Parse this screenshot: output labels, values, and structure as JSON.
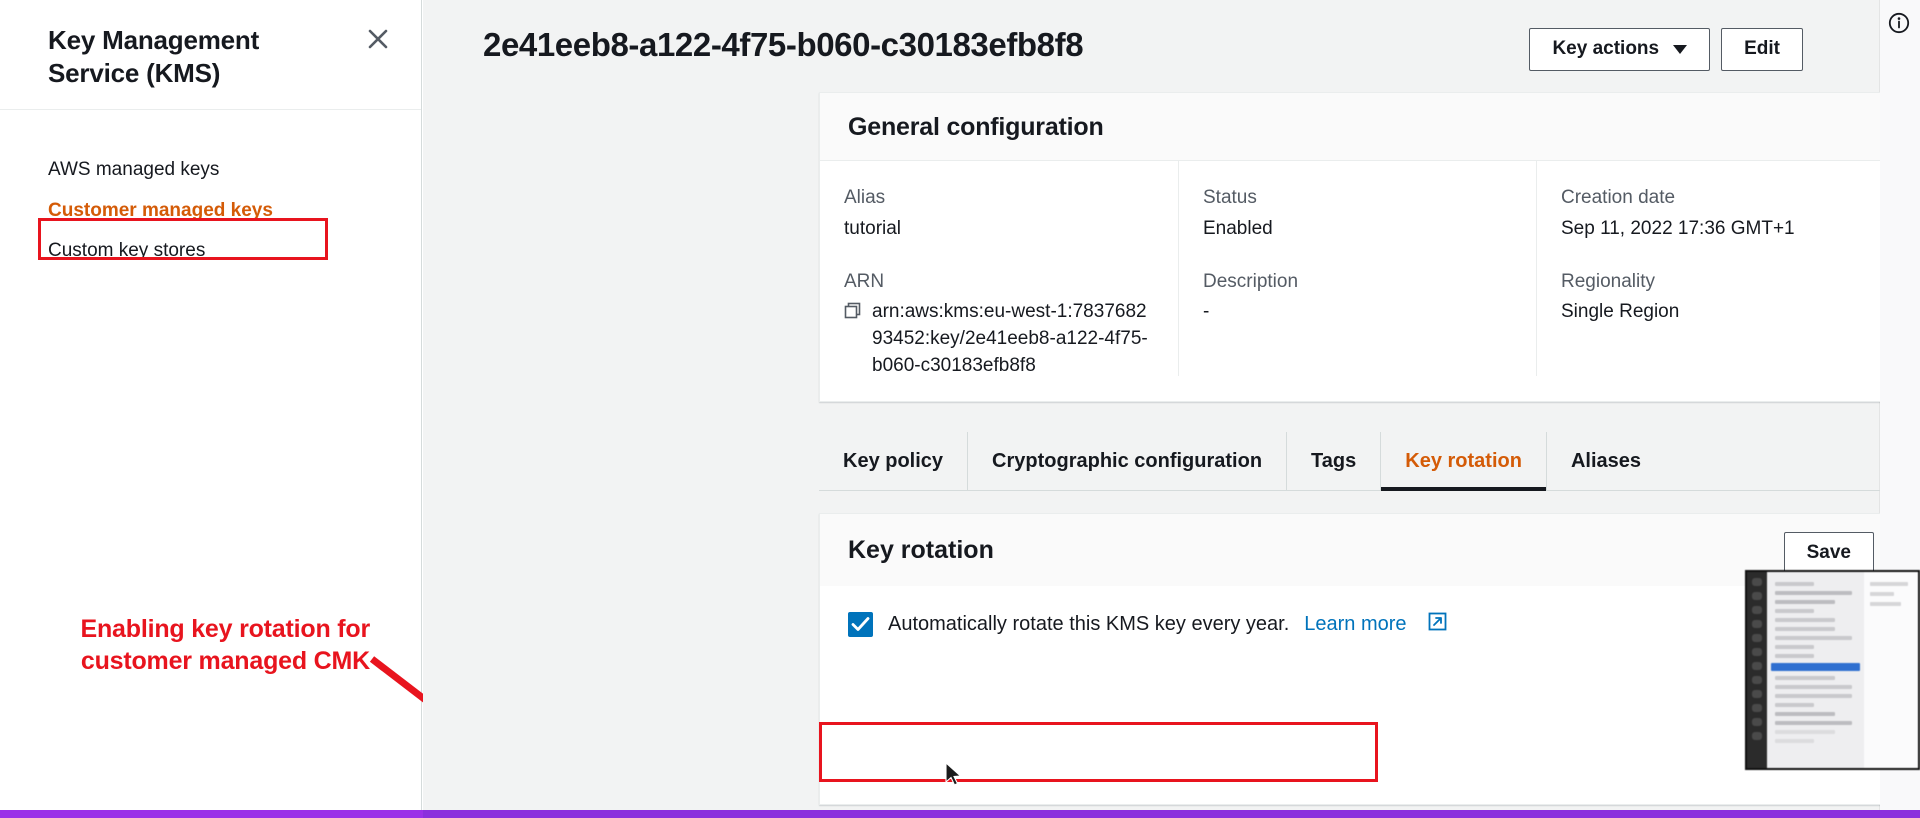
{
  "help_panel": {
    "title": "Key Management Service (KMS)",
    "close_icon": "close-icon",
    "nav_items": [
      {
        "label": "AWS managed keys",
        "selected": false
      },
      {
        "label": "Customer managed keys",
        "selected": true
      },
      {
        "label": "Custom key stores",
        "selected": false
      }
    ]
  },
  "annotation": {
    "text": "Enabling key rotation for customer managed CMK",
    "color": "#e8141e"
  },
  "header": {
    "key_id": "2e41eeb8-a122-4f75-b060-c30183efb8f8",
    "key_actions_label": "Key actions",
    "edit_label": "Edit",
    "info_icon": "info-circle-icon"
  },
  "general_configuration": {
    "heading": "General configuration",
    "fields": {
      "alias_label": "Alias",
      "alias_value": "tutorial",
      "arn_label": "ARN",
      "arn_value": "arn:aws:kms:eu-west-1:783768293452:key/2e41eeb8-a122-4f75-b060-c30183efb8f8",
      "status_label": "Status",
      "status_value": "Enabled",
      "description_label": "Description",
      "description_value": "-",
      "creation_date_label": "Creation date",
      "creation_date_value": "Sep 11, 2022 17:36 GMT+1",
      "regionality_label": "Regionality",
      "regionality_value": "Single Region"
    },
    "copy_icon": "copy-icon"
  },
  "tabs": [
    {
      "label": "Key policy",
      "active": false
    },
    {
      "label": "Cryptographic configuration",
      "active": false
    },
    {
      "label": "Tags",
      "active": false
    },
    {
      "label": "Key rotation",
      "active": true
    },
    {
      "label": "Aliases",
      "active": false
    }
  ],
  "key_rotation": {
    "heading": "Key rotation",
    "save_label": "Save",
    "checkbox_checked": true,
    "checkbox_label": "Automatically rotate this KMS key every year.",
    "learn_more_label": "Learn more",
    "external_link_icon": "external-link-icon"
  },
  "colors": {
    "accent_orange": "#d45b07",
    "annotation_red": "#e8141e",
    "link_blue": "#0073bb",
    "checkbox_blue": "#0073bb",
    "bottom_bar_purple": "#9b30e8"
  }
}
